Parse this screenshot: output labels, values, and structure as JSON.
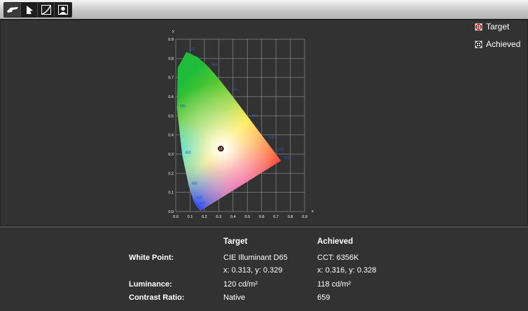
{
  "toolbar": {
    "tools": [
      {
        "icon": "hand-icon"
      },
      {
        "icon": "cursor-icon"
      },
      {
        "icon": "curve-icon"
      },
      {
        "icon": "person-icon"
      }
    ]
  },
  "legend": {
    "target_label": "Target",
    "achieved_label": "Achieved"
  },
  "chart_data": {
    "type": "scatter",
    "xlabel": "x",
    "ylabel": "y",
    "xlim": [
      0,
      0.9
    ],
    "ylim": [
      0,
      0.9
    ],
    "x_ticks": [
      "0.0",
      "0.1",
      "0.2",
      "0.3",
      "0.4",
      "0.5",
      "0.6",
      "0.7",
      "0.8",
      "0.9"
    ],
    "y_ticks": [
      "0.0",
      "0.1",
      "0.2",
      "0.3",
      "0.4",
      "0.5",
      "0.6",
      "0.7",
      "0.8",
      "0.9"
    ],
    "grid": true,
    "series": [
      {
        "name": "Target",
        "x": [
          0.313
        ],
        "y": [
          0.329
        ]
      },
      {
        "name": "Achieved",
        "x": [
          0.316
        ],
        "y": [
          0.328
        ]
      }
    ],
    "locus": [
      [
        0.1741,
        0.005
      ],
      [
        0.173,
        0.0048
      ],
      [
        0.1666,
        0.0089
      ],
      [
        0.144,
        0.0297
      ],
      [
        0.1241,
        0.0578
      ],
      [
        0.0913,
        0.1327
      ],
      [
        0.0454,
        0.295
      ],
      [
        0.0082,
        0.5384
      ],
      [
        0.0139,
        0.7502
      ],
      [
        0.0743,
        0.8338
      ],
      [
        0.1547,
        0.8059
      ],
      [
        0.2296,
        0.7543
      ],
      [
        0.3016,
        0.6923
      ],
      [
        0.3731,
        0.6245
      ],
      [
        0.4441,
        0.5547
      ],
      [
        0.5125,
        0.4866
      ],
      [
        0.5752,
        0.4242
      ],
      [
        0.627,
        0.3725
      ],
      [
        0.6658,
        0.334
      ],
      [
        0.6915,
        0.3083
      ],
      [
        0.7079,
        0.292
      ],
      [
        0.7347,
        0.2653
      ]
    ],
    "locus_labels": [
      {
        "text": "520",
        "x": 0.0743,
        "y": 0.8338
      },
      {
        "text": "540",
        "x": 0.2296,
        "y": 0.7543
      },
      {
        "text": "560",
        "x": 0.3731,
        "y": 0.6245
      },
      {
        "text": "580",
        "x": 0.5125,
        "y": 0.4866
      },
      {
        "text": "600",
        "x": 0.627,
        "y": 0.3725
      },
      {
        "text": "620",
        "x": 0.6915,
        "y": 0.3083
      },
      {
        "text": "700",
        "x": 0.7347,
        "y": 0.2653
      },
      {
        "text": "500",
        "x": 0.0082,
        "y": 0.5384
      },
      {
        "text": "490",
        "x": 0.0454,
        "y": 0.295
      },
      {
        "text": "480",
        "x": 0.0913,
        "y": 0.1327
      },
      {
        "text": "470",
        "x": 0.1241,
        "y": 0.0578
      },
      {
        "text": "460",
        "x": 0.144,
        "y": 0.0297
      }
    ]
  },
  "table": {
    "col_target": "Target",
    "col_achieved": "Achieved",
    "rows": [
      {
        "label": "White Point:",
        "target": "CIE Illuminant D65",
        "achieved": "CCT: 6356K"
      },
      {
        "label": "",
        "target": "x: 0.313, y: 0.329",
        "achieved": "x: 0.316, y: 0.328"
      },
      {
        "label": "Luminance:",
        "target": "120 cd/m²",
        "achieved": "118 cd/m²"
      },
      {
        "label": "Contrast Ratio:",
        "target": "Native",
        "achieved": "659"
      }
    ]
  },
  "colors": {
    "background": "#323232",
    "grid": "#8a8a8a",
    "target_marker": "#c0161c",
    "wavelength_label": "#2c5fb0"
  }
}
